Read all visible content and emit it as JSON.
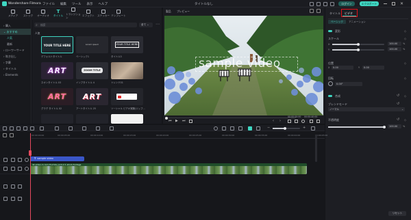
{
  "app": {
    "title": "Wondershare Filmora",
    "project_title": "タイトルなし",
    "menu": [
      "ファイル",
      "編集",
      "ツール",
      "表示",
      "ヘルプ"
    ],
    "login_label": "ログイン",
    "export_label": "エクスポート"
  },
  "media_tabs": [
    {
      "label": "メディア"
    },
    {
      "label": "ストック"
    },
    {
      "label": "オーディオ"
    },
    {
      "label": "タイトル"
    },
    {
      "label": "トランジション"
    },
    {
      "label": "エフェクト"
    },
    {
      "label": "ステッカー"
    },
    {
      "label": "テンプレート"
    }
  ],
  "sidebar": {
    "items": [
      "購入",
      "おすすめ",
      "人気",
      "最新",
      "ローワーサード",
      "吹き出し",
      "字幕",
      "タイトル",
      "Elements"
    ]
  },
  "search": {
    "placeholder": "検索",
    "filter": "全て"
  },
  "assets": {
    "section": "人気",
    "cards": [
      {
        "label": "デフォルトタイトル",
        "thumb": "YOUR TITLE HERE"
      },
      {
        "label": "ベーシック1",
        "thumb": "Lorem ipsum"
      },
      {
        "label": "タイトル3",
        "thumb": "YOUR TITLE HERE"
      },
      {
        "label": "ネオンタイトル 03",
        "thumb": "ART"
      },
      {
        "label": "インプタイトル 4",
        "thumb": "ZOOM TITLE"
      },
      {
        "label": "トレンド01",
        "thumb": ""
      },
      {
        "label": "グラデ タイトル 02",
        "thumb": "ART"
      },
      {
        "label": "アートタイトル 25",
        "thumb": "ART"
      },
      {
        "label": "ソーシャル ピデオ実験(ジップ...",
        "thumb": ""
      }
    ]
  },
  "preview": {
    "tabs": [
      "製品",
      "プレビュー"
    ],
    "overlay_text": "sample video",
    "time": "00:00:00:00",
    "duration": "00:00:40:00"
  },
  "inspector": {
    "tabs": [
      "タイトル",
      "ビデオ"
    ],
    "subtabs": [
      "ベーシック",
      "アニメーション"
    ],
    "sections": {
      "transform": "変形",
      "scale": "スケール",
      "position": "位置",
      "rotate": "回転",
      "composite": "合成",
      "blend": "ブレンドモード",
      "opacity": "不透明度"
    },
    "scale_x": "100.00",
    "scale_y": "100.00",
    "pos_x": "0.00",
    "pos_y": "0.00",
    "rotate": "0.00°",
    "blend_value": "ノーマル",
    "opacity_value": "100.00",
    "reset_label": "リセット",
    "scale_unit": "%",
    "pos_x_label": "X",
    "pos_y_label": "Y"
  },
  "timeline": {
    "ticks": [
      "00:00:00:00",
      "00:00:05:00",
      "00:00:10:00",
      "00:00:15:00",
      "00:00:20:00",
      "00:00:25:00",
      "00:00:30:00",
      "00:00:35:00",
      "00:00:40:00",
      "00:00:45:00"
    ],
    "title_clip": "sample video",
    "title_clip_short": "T",
    "video_clip": "4k-video-in-rain-thumbs-yard-2-1-stock-footage"
  },
  "colors": {
    "accent": "#3fd6c2",
    "highlight": "#e3131b",
    "clip_title": "#3a56c8",
    "clip_video": "#2d6b3a",
    "playhead": "#e84a5f"
  }
}
